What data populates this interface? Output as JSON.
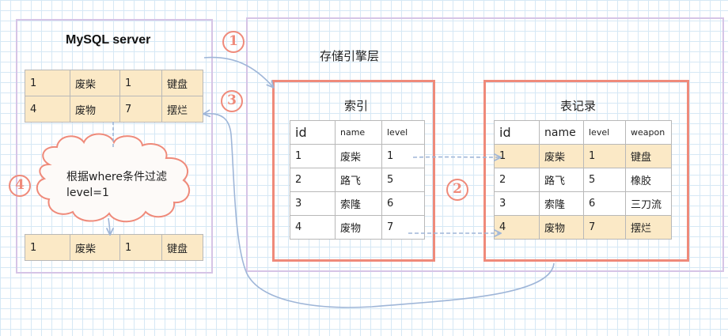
{
  "mysql_server": {
    "title": "MySQL server",
    "table_top": [
      [
        "1",
        "废柴",
        "1",
        "键盘"
      ],
      [
        "4",
        "废物",
        "7",
        "摆烂"
      ]
    ],
    "cloud_text_line1": "根据where条件过滤",
    "cloud_text_line2": "level=1",
    "table_result": [
      [
        "1",
        "废柴",
        "1",
        "键盘"
      ]
    ]
  },
  "storage_layer": {
    "title": "存储引擎层",
    "index_table": {
      "title": "索引",
      "headers": [
        "id",
        "name",
        "level"
      ],
      "rows": [
        [
          "1",
          "废柴",
          "1"
        ],
        [
          "2",
          "路飞",
          "5"
        ],
        [
          "3",
          "索隆",
          "6"
        ],
        [
          "4",
          "废物",
          "7"
        ]
      ]
    },
    "record_table": {
      "title": "表记录",
      "headers": [
        "id",
        "name",
        "level",
        "weapon"
      ],
      "rows": [
        [
          "1",
          "废柴",
          "1",
          "键盘"
        ],
        [
          "2",
          "路飞",
          "5",
          "橡胶"
        ],
        [
          "3",
          "索隆",
          "6",
          "三刀流"
        ],
        [
          "4",
          "废物",
          "7",
          "摆烂"
        ]
      ],
      "highlighted_rows": [
        0,
        3
      ]
    }
  },
  "steps": [
    "①",
    "②",
    "③",
    "④"
  ],
  "colors": {
    "accent_red": "#ef8a7a",
    "frame_purple": "#d6c4e6",
    "highlight_row": "#fbe9c6",
    "arrow_blue": "#9fb6d8",
    "grid": "#d6e8f5"
  }
}
